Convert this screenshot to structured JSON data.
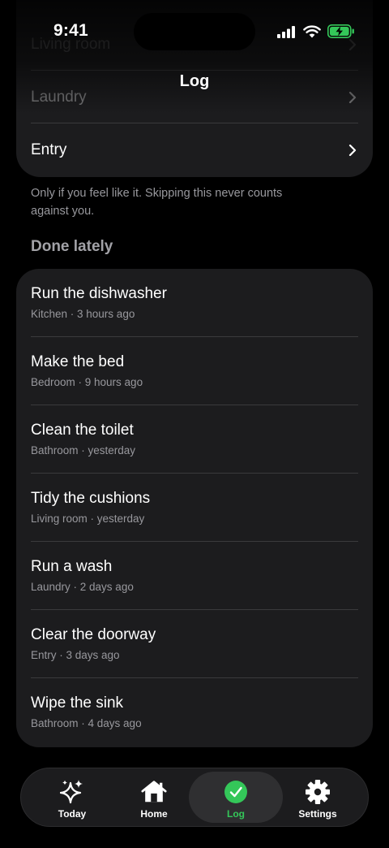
{
  "status_bar": {
    "time": "9:41"
  },
  "header": {
    "title": "Log"
  },
  "rooms_card": {
    "rows": [
      {
        "label": "Living room"
      },
      {
        "label": "Laundry"
      },
      {
        "label": "Entry"
      }
    ]
  },
  "note": "Only if you feel like it. Skipping this never counts against you.",
  "section": {
    "title": "Done lately"
  },
  "done_lately": [
    {
      "title": "Run the dishwasher",
      "meta": "Kitchen · 3 hours ago"
    },
    {
      "title": "Make the bed",
      "meta": "Bedroom · 9 hours ago"
    },
    {
      "title": "Clean the toilet",
      "meta": "Bathroom · yesterday"
    },
    {
      "title": "Tidy the cushions",
      "meta": "Living room · yesterday"
    },
    {
      "title": "Run a wash",
      "meta": "Laundry · 2 days ago"
    },
    {
      "title": "Clear the doorway",
      "meta": "Entry · 3 days ago"
    },
    {
      "title": "Wipe the sink",
      "meta": "Bathroom · 4 days ago"
    }
  ],
  "tabs": [
    {
      "label": "Today",
      "icon": "sparkles-icon"
    },
    {
      "label": "Home",
      "icon": "house-icon"
    },
    {
      "label": "Log",
      "icon": "checkmark-circle-icon",
      "active": true
    },
    {
      "label": "Settings",
      "icon": "gear-icon"
    }
  ],
  "colors": {
    "accent": "#34c759",
    "card": "#1c1c1e",
    "secondary_text": "#98989d"
  }
}
